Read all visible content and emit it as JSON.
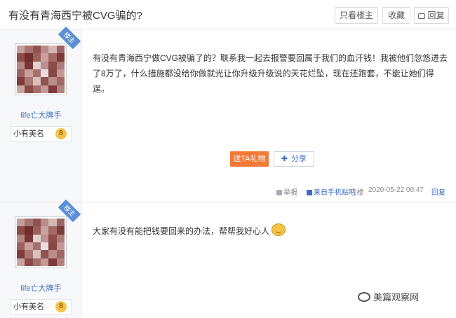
{
  "header": {
    "title": "有没有青海西宁被CVG骗的?",
    "only_owner": "只看楼主",
    "favorite": "收藏",
    "reply": "回复"
  },
  "posts": [
    {
      "badge": "楼主",
      "username": "life亡大牌手",
      "level_title": "小有美名",
      "level": "8",
      "content": "有没有青海西宁做CVG被骗了的？联系我一起去报警要回属于我们的血汗钱！我被他们忽悠进去了8万了，什么措施都没给你做就光让你升级升级说的天花烂坠，现在还跑套，不能让她们得逞。",
      "gift": "送TA礼物",
      "share": "分享",
      "report": "举报",
      "source": "来自手机贴吧",
      "floor": "1楼",
      "time": "2020-05-22 00:47",
      "reply": "回复"
    },
    {
      "badge": "楼主",
      "username": "life亡大牌手",
      "level_title": "小有美名",
      "level": "8",
      "content": "大家有没有能把钱要回来的办法，帮帮我好心人"
    }
  ],
  "watermark": "美篇观察网",
  "colors": {
    "accent": "#3b6bc4",
    "gift": "#f57937",
    "badge": "#5b8fd8"
  }
}
